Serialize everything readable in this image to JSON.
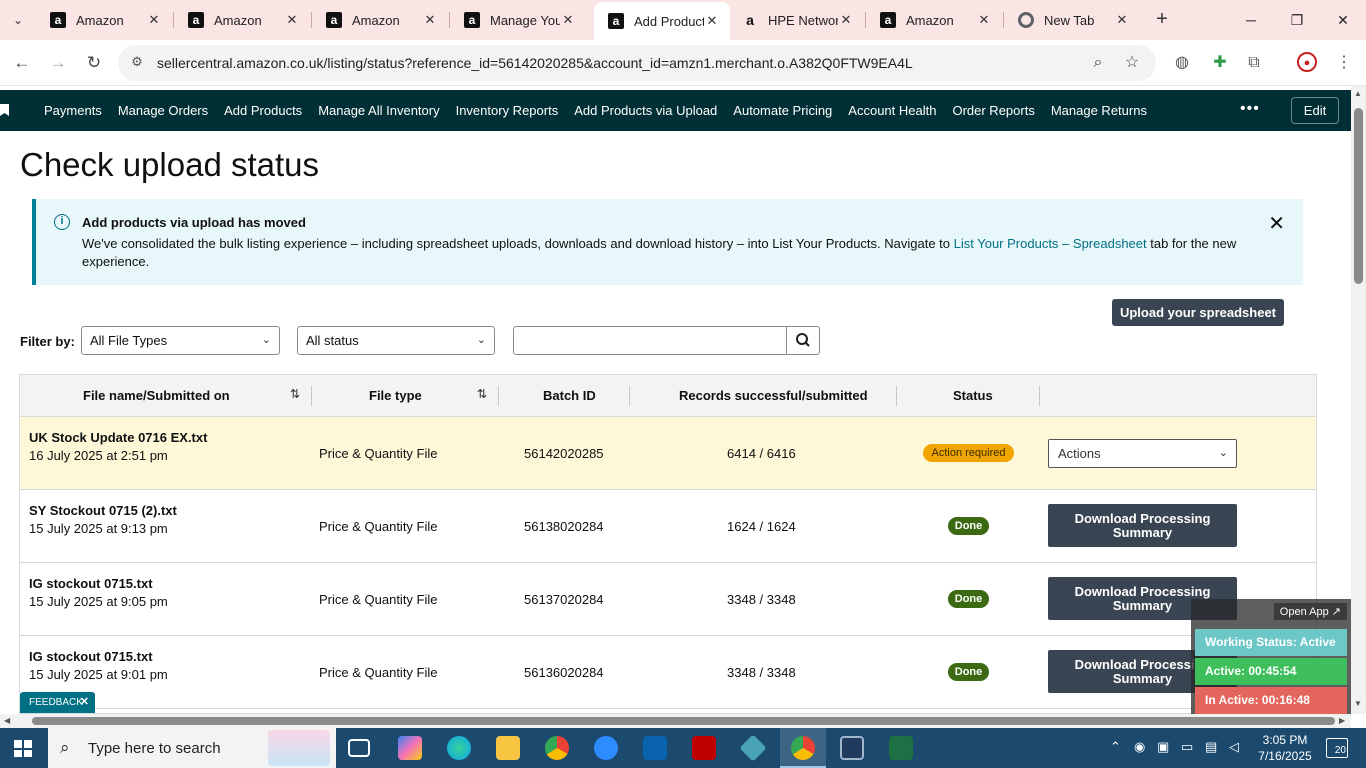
{
  "browser": {
    "tabs": [
      {
        "title": "Amazon",
        "icon": "amazon-favicon"
      },
      {
        "title": "Amazon",
        "icon": "amazon-favicon"
      },
      {
        "title": "Amazon",
        "icon": "amazon-favicon"
      },
      {
        "title": "Manage Your",
        "icon": "amazon-favicon"
      },
      {
        "title": "Add Product",
        "icon": "amazon-favicon",
        "active": true
      },
      {
        "title": "HPE Networ",
        "icon": "hpe-favicon"
      },
      {
        "title": "Amazon",
        "icon": "amazon-favicon"
      },
      {
        "title": "New Tab",
        "icon": "chrome-favicon"
      }
    ],
    "url": "sellercentral.amazon.co.uk/listing/status?reference_id=56142020285&account_id=amzn1.merchant.o.A382Q0FTW9EA4L"
  },
  "nav": {
    "links": [
      "Payments",
      "Manage Orders",
      "Add Products",
      "Manage All Inventory",
      "Inventory Reports",
      "Add Products via Upload",
      "Automate Pricing",
      "Account Health",
      "Order Reports",
      "Manage Returns"
    ],
    "edit_label": "Edit"
  },
  "page": {
    "title": "Check upload status"
  },
  "banner": {
    "title": "Add products via upload has moved",
    "body_text": "We've consolidated the bulk listing experience – including spreadsheet uploads, downloads and download history – into List Your Products. Navigate to ",
    "link1": "List Your Products",
    "dash": " – ",
    "link2": "Spreadsheet",
    "body_end": " tab for the new experience."
  },
  "upload_button": "Upload your spreadsheet",
  "filters": {
    "label": "Filter by:",
    "file_type": "All File Types",
    "status": "All status",
    "search_value": ""
  },
  "table": {
    "headers": [
      "File name/Submitted on",
      "File type",
      "Batch ID",
      "Records successful/submitted",
      "Status"
    ],
    "rows": [
      {
        "name": "UK Stock Update 0716 EX.txt",
        "date": "16 July 2025 at 2:51 pm",
        "type": "Price & Quantity File",
        "batch": "56142020285",
        "records": "6414 / 6416",
        "status": "Action required",
        "action": "Actions"
      },
      {
        "name": "SY Stockout 0715 (2).txt",
        "date": "15 July 2025 at 9:13 pm",
        "type": "Price & Quantity File",
        "batch": "56138020284",
        "records": "1624 / 1624",
        "status": "Done",
        "action": "Download Processing Summary"
      },
      {
        "name": "IG stockout 0715.txt",
        "date": "15 July 2025 at 9:05 pm",
        "type": "Price & Quantity File",
        "batch": "56137020284",
        "records": "3348 / 3348",
        "status": "Done",
        "action": "Download Processing Summary"
      },
      {
        "name": "IG stockout 0715.txt",
        "date": "15 July 2025 at 9:01 pm",
        "type": "Price & Quantity File",
        "batch": "56136020284",
        "records": "3348 / 3348",
        "status": "Done",
        "action": "Download Processing Summary"
      }
    ]
  },
  "feedback": "FEEDBACK",
  "widget": {
    "open_app": "Open App ↗",
    "working_status": "Working Status: Active",
    "active": "Active: 00:45:54",
    "inactive": "In Active: 00:16:48"
  },
  "taskbar": {
    "search_placeholder": "Type here to search",
    "time": "3:05 PM",
    "date": "7/16/2025",
    "notifications": "20"
  }
}
